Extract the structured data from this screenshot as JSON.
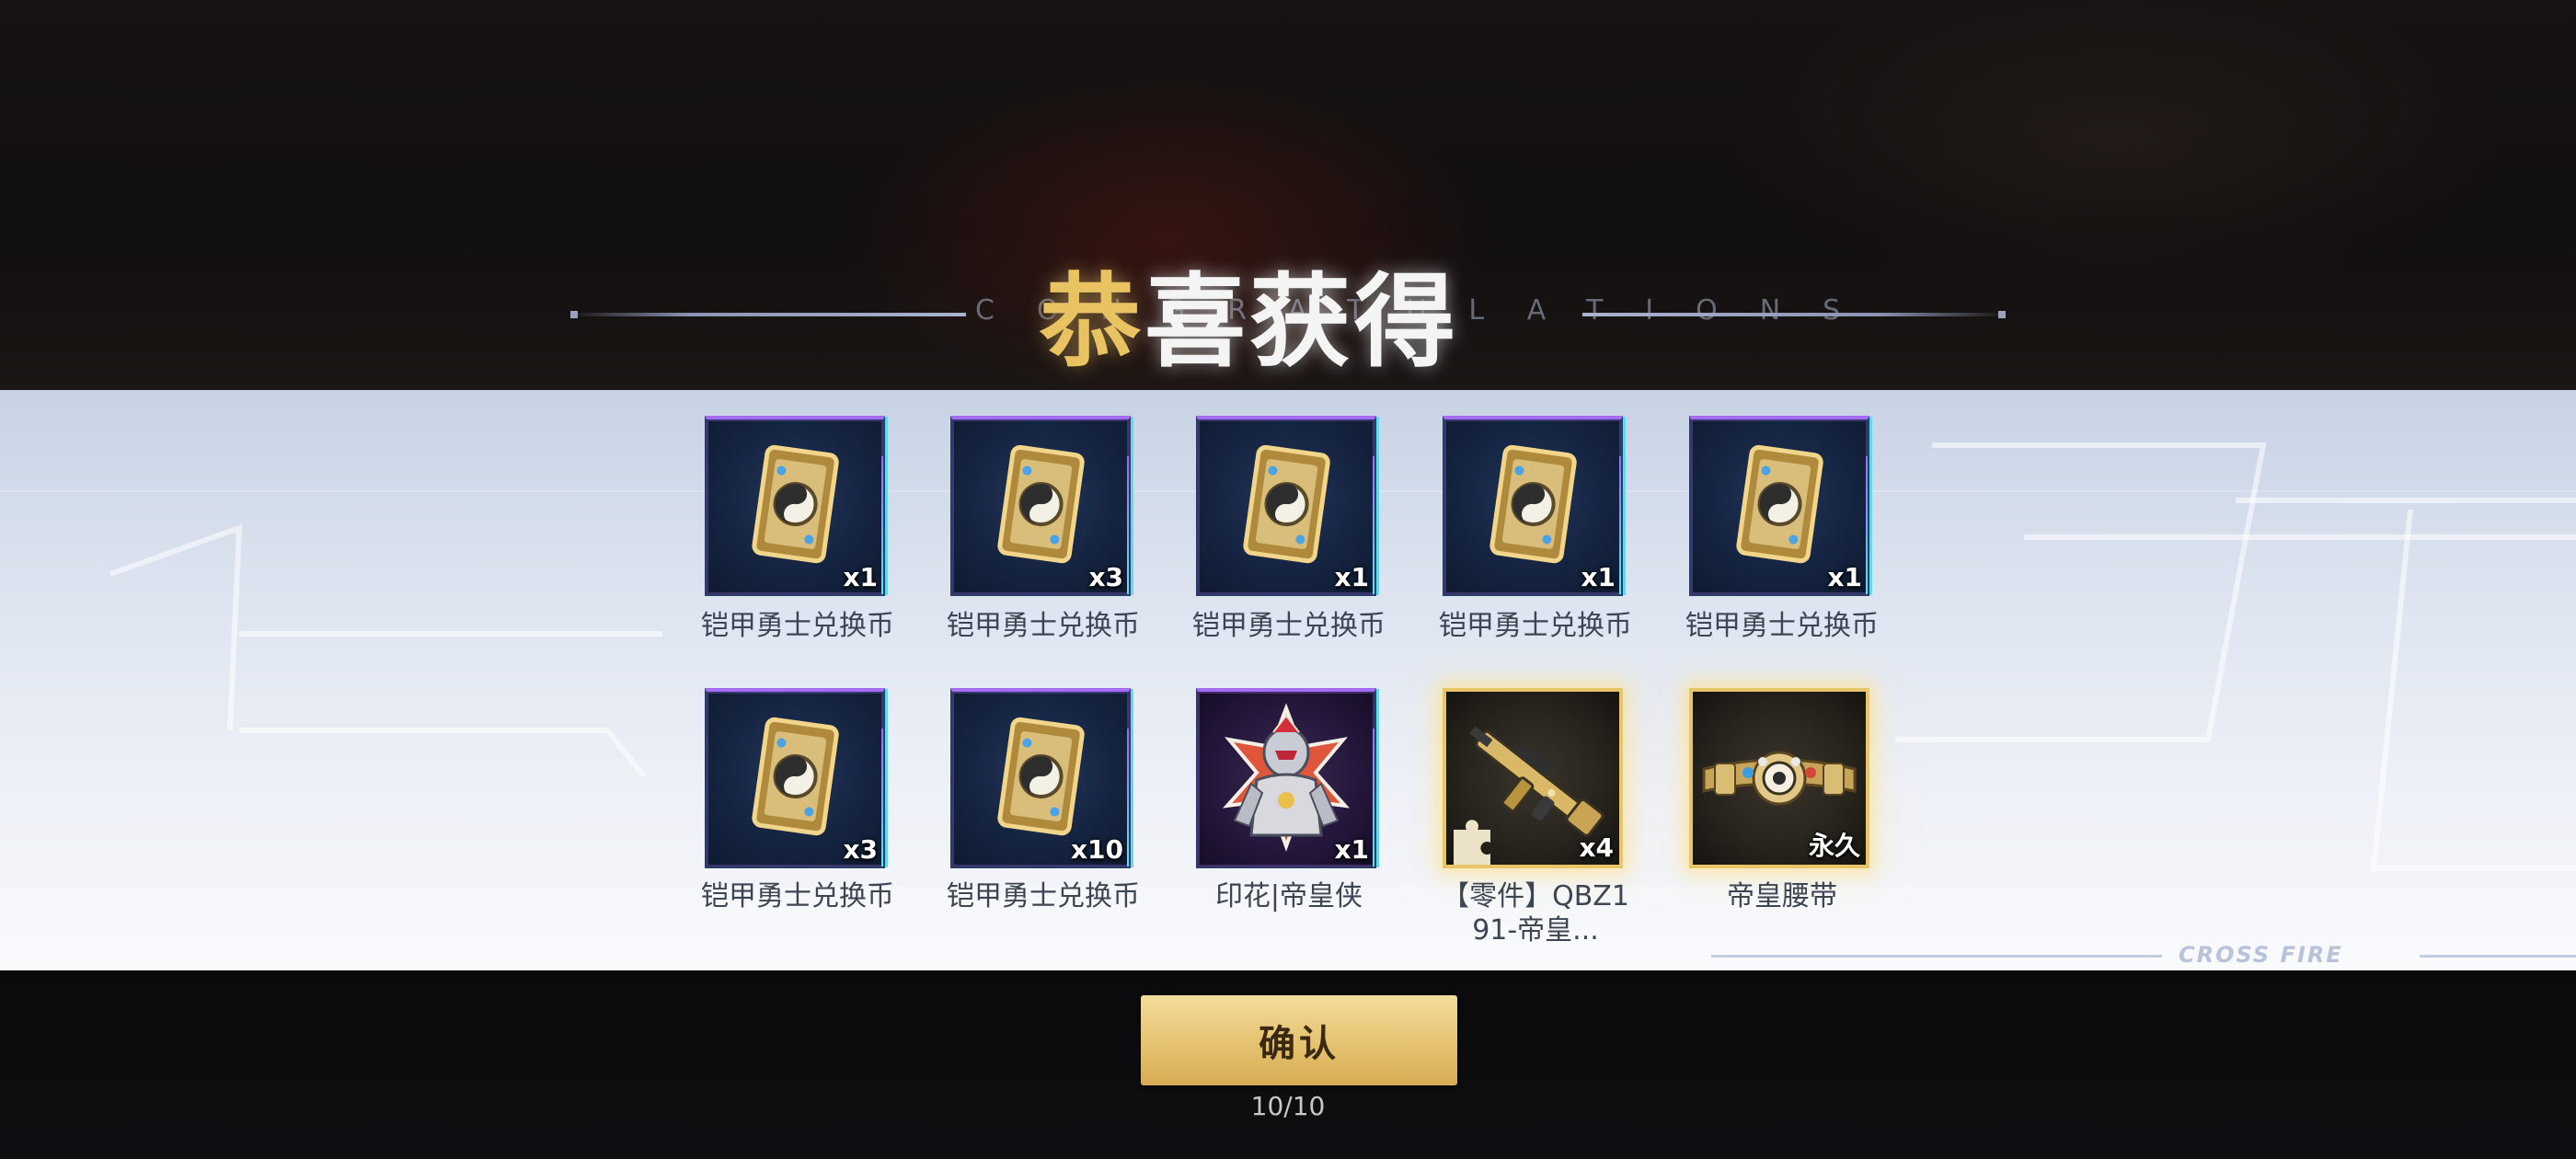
{
  "header": {
    "title_first": "恭",
    "title_rest": "喜获得",
    "subtitle": "CONGRATULATIONS"
  },
  "items": [
    {
      "label": "铠甲勇士兑换币",
      "qty": "x1",
      "icon": "coin-card-icon",
      "rarity": "purple"
    },
    {
      "label": "铠甲勇士兑换币",
      "qty": "x3",
      "icon": "coin-card-icon",
      "rarity": "purple"
    },
    {
      "label": "铠甲勇士兑换币",
      "qty": "x1",
      "icon": "coin-card-icon",
      "rarity": "purple"
    },
    {
      "label": "铠甲勇士兑换币",
      "qty": "x1",
      "icon": "coin-card-icon",
      "rarity": "purple"
    },
    {
      "label": "铠甲勇士兑换币",
      "qty": "x1",
      "icon": "coin-card-icon",
      "rarity": "purple"
    },
    {
      "label": "铠甲勇士兑换币",
      "qty": "x3",
      "icon": "coin-card-icon",
      "rarity": "purple"
    },
    {
      "label": "铠甲勇士兑换币",
      "qty": "x10",
      "icon": "coin-card-icon",
      "rarity": "purple"
    },
    {
      "label": "印花|帝皇侠",
      "qty": "x1",
      "icon": "armored-warrior-sticker-icon",
      "rarity": "purple"
    },
    {
      "label": "【零件】QBZ191-帝皇...",
      "qty": "x4",
      "icon": "rifle-part-icon",
      "rarity": "gold"
    },
    {
      "label": "帝皇腰带",
      "qty": "永久",
      "icon": "emperor-belt-icon",
      "rarity": "gold"
    }
  ],
  "brand": "CROSS FIRE",
  "confirm_label": "确认",
  "progress": "10/10",
  "colors": {
    "gold_accent": "#e7c568",
    "purple_rarity": "#a46cf0",
    "title_gold": "#e9c262",
    "button_gold": "#e5c270"
  }
}
